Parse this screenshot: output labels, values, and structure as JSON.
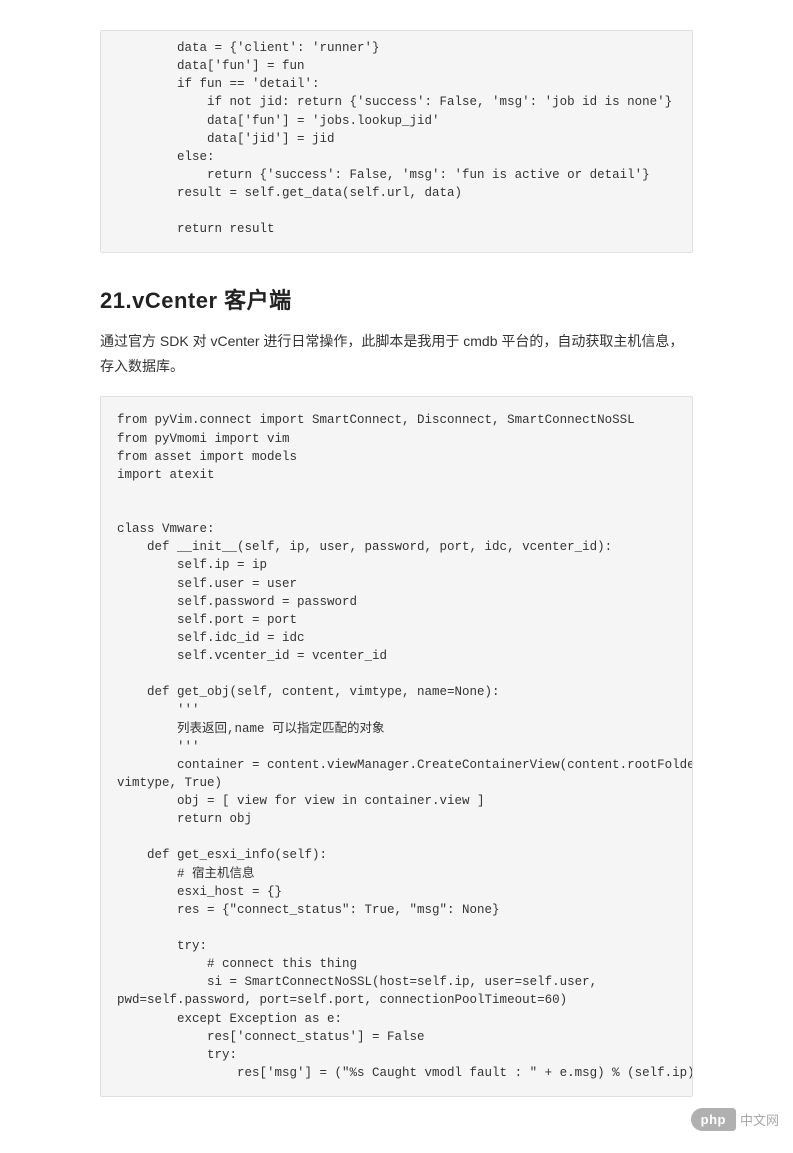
{
  "code_block_1": "        data = {'client': 'runner'}\n        data['fun'] = fun\n        if fun == 'detail':\n            if not jid: return {'success': False, 'msg': 'job id is none'}\n            data['fun'] = 'jobs.lookup_jid'\n            data['jid'] = jid\n        else:\n            return {'success': False, 'msg': 'fun is active or detail'}\n        result = self.get_data(self.url, data)\n\n        return result",
  "heading": "21.vCenter 客户端",
  "description": "通过官方 SDK 对 vCenter 进行日常操作，此脚本是我用于 cmdb 平台的，自动获取主机信息，存入数据库。",
  "code_block_2": "from pyVim.connect import SmartConnect, Disconnect, SmartConnectNoSSL\nfrom pyVmomi import vim\nfrom asset import models\nimport atexit\n\n\nclass Vmware:\n    def __init__(self, ip, user, password, port, idc, vcenter_id):\n        self.ip = ip\n        self.user = user\n        self.password = password\n        self.port = port\n        self.idc_id = idc\n        self.vcenter_id = vcenter_id\n\n    def get_obj(self, content, vimtype, name=None):\n        '''\n        列表返回,name 可以指定匹配的对象\n        '''\n        container = content.viewManager.CreateContainerView(content.rootFolder,\nvimtype, True)\n        obj = [ view for view in container.view ]\n        return obj\n\n    def get_esxi_info(self):\n        # 宿主机信息\n        esxi_host = {}\n        res = {\"connect_status\": True, \"msg\": None}\n\n        try:\n            # connect this thing\n            si = SmartConnectNoSSL(host=self.ip, user=self.user,\npwd=self.password, port=self.port, connectionPoolTimeout=60)\n        except Exception as e:\n            res['connect_status'] = False\n            try:\n                res['msg'] = (\"%s Caught vmodl fault : \" + e.msg) % (self.ip)",
  "watermark": {
    "logo": "php",
    "text": "中文网"
  }
}
